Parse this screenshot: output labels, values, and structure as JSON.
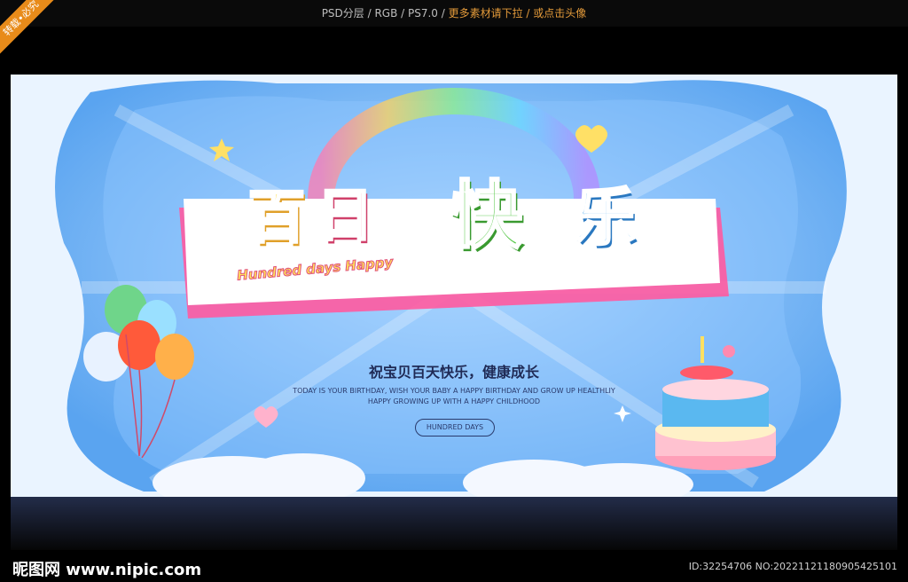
{
  "top_bar": {
    "info": "PSD分层 / RGB / PS7.0 / ",
    "more": "更多素材请下拉 / 或点击头像"
  },
  "corner_badge": "转载•必究",
  "banner": {
    "title_cn": [
      "百",
      "日",
      "快",
      "乐"
    ],
    "title_en": "Hundred days Happy",
    "subtitle_cn": "祝宝贝百天快乐，健康成长",
    "subtitle_en_line1": "TODAY IS YOUR BIRTHDAY, WISH YOUR BABY A HAPPY BIRTHDAY AND GROW UP HEALTHLIY",
    "subtitle_en_line2": "HAPPY GROWING UP WITH A HAPPY CHILDHOOD",
    "pill_text": "HUNDRED DAYS"
  },
  "footer": {
    "logo": "昵图网 www.nipic.com",
    "id": "ID:32254706 NO:20221121180905425101"
  }
}
